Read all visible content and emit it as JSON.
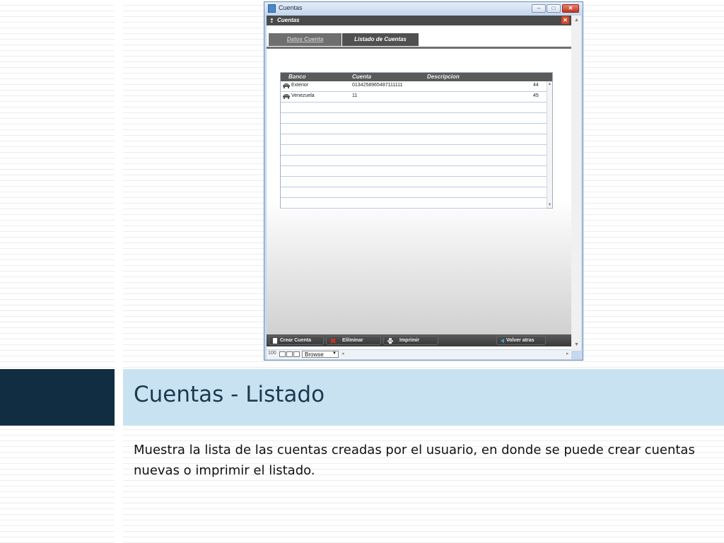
{
  "window": {
    "title": "Cuentas",
    "inner_title": "Cuentas"
  },
  "tabs": [
    {
      "label": "Datos Cuenta",
      "active": false
    },
    {
      "label": "Listado de Cuentas",
      "active": true
    }
  ],
  "table": {
    "headers": [
      "Banco",
      "Cuenta",
      "Descripcion"
    ],
    "rows": [
      {
        "banco": "Exterior",
        "cuenta": "0134258965487111111",
        "id": "44"
      },
      {
        "banco": "Venezuela",
        "cuenta": "11",
        "id": "45"
      }
    ],
    "empty_rows": 10
  },
  "toolbar": {
    "crear": "Crear Cuenta",
    "eliminar": "Elilminar",
    "imprimir": "Imprimir",
    "volver": "Volver atras"
  },
  "statusbar": {
    "zoom": "100",
    "mode": "Browse"
  },
  "slide": {
    "title": "Cuentas - Listado",
    "body": "Muestra la lista de las cuentas creadas por el usuario, en donde se puede crear cuentas nuevas o imprimir el listado."
  },
  "colors": {
    "dark_band": "#112d42",
    "light_band": "#c9e2f2",
    "title_text": "#1b3a4f"
  }
}
